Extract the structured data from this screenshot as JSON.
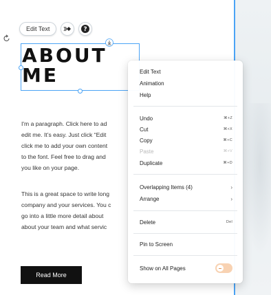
{
  "toolbar": {
    "edit_text_label": "Edit Text",
    "animation_icon": "animation-icon",
    "help_icon": "help-icon"
  },
  "heading": {
    "line1": "ABOUT",
    "line2": "ME"
  },
  "paragraph_1": [
    "I'm a paragraph. Click here to ad",
    "edit me. It’s easy. Just click “Edit",
    "click me to add your own content",
    "to the font. Feel free to drag and",
    "you like on your page."
  ],
  "paragraph_2": [
    "This is a great space to write long",
    "company and your services. You c",
    "go into a little more detail about",
    "about your team and what servic"
  ],
  "read_more_label": "Read More",
  "context_menu": {
    "edit_text": "Edit Text",
    "animation": "Animation",
    "help": "Help",
    "undo": "Undo",
    "undo_sc": "⌘+Z",
    "cut": "Cut",
    "cut_sc": "⌘+X",
    "copy": "Copy",
    "copy_sc": "⌘+C",
    "paste": "Paste",
    "paste_sc": "⌘+V",
    "duplicate": "Duplicate",
    "duplicate_sc": "⌘+D",
    "overlapping": "Overlapping Items (4)",
    "arrange": "Arrange",
    "delete": "Delete",
    "delete_sc": "Del",
    "pin": "Pin to Screen",
    "show_all": "Show on All Pages",
    "show_all_on": false
  },
  "colors": {
    "selection": "#4aa3f5",
    "toggle_off": "#f8d2b2",
    "button_dark": "#111111"
  }
}
